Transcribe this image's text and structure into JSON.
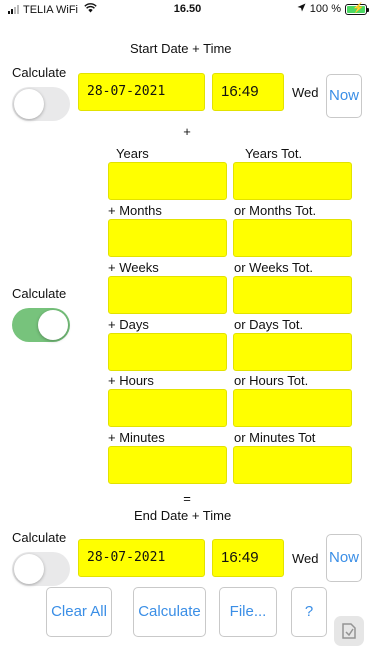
{
  "status_bar": {
    "carrier": "TELIA WiFi",
    "time": "16.50",
    "battery_percent": "100 %",
    "battery_level": 1.0
  },
  "start": {
    "heading": "Start Date + Time",
    "calculate_label": "Calculate",
    "toggle_on": false,
    "date": "28-07-2021",
    "time": "16:49",
    "weekday": "Wed",
    "now_label": "Now"
  },
  "plus_sign": "+",
  "left_col": {
    "labels": [
      "Years",
      "+ Months",
      "+ Weeks",
      "+ Days",
      "+ Hours",
      "+ Minutes"
    ],
    "values": [
      "",
      "",
      "",
      "",
      "",
      ""
    ]
  },
  "right_col": {
    "labels": [
      "Years Tot.",
      "or Months Tot.",
      "or Weeks Tot.",
      "or Days Tot.",
      "or Hours Tot.",
      "or Minutes Tot"
    ],
    "values": [
      "",
      "",
      "",
      "",
      "",
      ""
    ]
  },
  "middle": {
    "calculate_label": "Calculate",
    "toggle_on": true
  },
  "equals_sign": "=",
  "end": {
    "heading": "End Date + Time",
    "calculate_label": "Calculate",
    "toggle_on": false,
    "date": "28-07-2021",
    "time": "16:49",
    "weekday": "Wed",
    "now_label": "Now"
  },
  "actions": {
    "clear_all": "Clear All",
    "calculate": "Calculate",
    "file": "File...",
    "help": "?"
  },
  "colors": {
    "field": "#ffff00",
    "toggle_on": "#77c37c",
    "button_text": "#3a8ee6"
  }
}
